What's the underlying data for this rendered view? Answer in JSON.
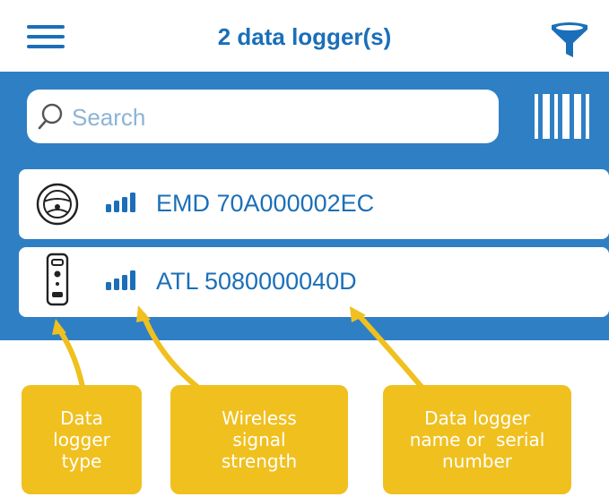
{
  "app_bar": {
    "title": "2 data logger(s)",
    "menu_icon": "hamburger-menu-icon",
    "filter_icon": "filter-funnel-icon"
  },
  "search": {
    "placeholder": "Search",
    "value": "",
    "search_icon": "magnifier-icon",
    "barcode_icon": "barcode-scan-icon"
  },
  "loggers": [
    {
      "type_icon": "steering-wheel-icon",
      "signal_icon": "signal-strength-icon",
      "label": "EMD 70A000002EC"
    },
    {
      "type_icon": "device-logger-icon",
      "signal_icon": "signal-strength-icon",
      "label": "ATL 5080000040D"
    }
  ],
  "callouts": [
    {
      "lines": [
        "Data",
        "logger",
        "type"
      ]
    },
    {
      "lines": [
        "Wireless",
        "signal",
        "strength"
      ]
    },
    {
      "lines": [
        "Data logger",
        "name or  serial",
        "number"
      ]
    }
  ],
  "colors": {
    "brand_blue": "#1b6fb8",
    "panel_blue": "#2f7fc4",
    "callout_yellow": "#f0c01f"
  }
}
